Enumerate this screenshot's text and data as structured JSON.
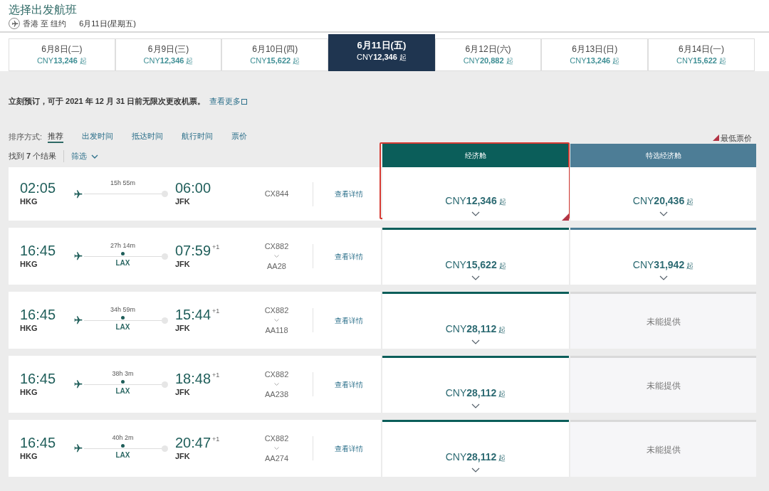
{
  "header": {
    "title": "选择出发航班",
    "route": "香港 至 纽约",
    "date": "6月11日(星期五)"
  },
  "dates": [
    {
      "label": "6月8日(二)",
      "price": "CNY**13,246**",
      "suffix": "起",
      "selected": false
    },
    {
      "label": "6月9日(三)",
      "price": "CNY**12,346**",
      "suffix": "起",
      "selected": false
    },
    {
      "label": "6月10日(四)",
      "price": "CNY**15,622**",
      "suffix": "起",
      "selected": false
    },
    {
      "label": "6月11日(五)",
      "price": "CNY**12,346**",
      "suffix": "起",
      "selected": true
    },
    {
      "label": "6月12日(六)",
      "price": "CNY**20,882**",
      "suffix": "起",
      "selected": false
    },
    {
      "label": "6月13日(日)",
      "price": "CNY**13,246**",
      "suffix": "起",
      "selected": false
    },
    {
      "label": "6月14日(一)",
      "price": "CNY**15,622**",
      "suffix": "起",
      "selected": false
    }
  ],
  "notice": {
    "text": "立刻预订，可于 2021 年 12 月 31 日前无限次更改机票。",
    "link": "查看更多"
  },
  "sort": {
    "label": "排序方式:",
    "options": [
      {
        "label": "推荐",
        "selected": true
      },
      {
        "label": "出发时间",
        "selected": false
      },
      {
        "label": "抵达时间",
        "selected": false
      },
      {
        "label": "航行时间",
        "selected": false
      },
      {
        "label": "票价",
        "selected": false
      }
    ]
  },
  "legend": "最低票价",
  "results": {
    "count": "找到 **7** 个结果",
    "filter": "筛选"
  },
  "cabins": [
    {
      "name": "经济舱",
      "color": "#0b5e5a",
      "highlighted": true
    },
    {
      "name": "特选经济舱",
      "color": "#4d7d96",
      "highlighted": false
    }
  ],
  "flights": [
    {
      "depart": "02:05",
      "from": "HKG",
      "duration": "15h 55m",
      "arrive": "06:00",
      "to": "JFK",
      "numbers": [
        "CX844"
      ],
      "details": "查看详情",
      "fares": [
        {
          "kind": "price",
          "price": "CNY**12,346**",
          "suffix": "起",
          "lowest": true
        },
        {
          "kind": "price",
          "price": "CNY**20,436**",
          "suffix": "起",
          "lowest": false
        }
      ]
    },
    {
      "depart": "16:45",
      "from": "HKG",
      "duration": "27h 14m",
      "stop": "LAX",
      "arrive": "07:59",
      "day_offset": "+1",
      "to": "JFK",
      "numbers": [
        "CX882",
        "AA28"
      ],
      "details": "查看详情",
      "fares": [
        {
          "kind": "price",
          "price": "CNY**15,622**",
          "suffix": "起",
          "lowest": false
        },
        {
          "kind": "price",
          "price": "CNY**31,942**",
          "suffix": "起",
          "lowest": false
        }
      ]
    },
    {
      "depart": "16:45",
      "from": "HKG",
      "duration": "34h 59m",
      "stop": "LAX",
      "arrive": "15:44",
      "day_offset": "+1",
      "to": "JFK",
      "numbers": [
        "CX882",
        "AA118"
      ],
      "details": "查看详情",
      "fares": [
        {
          "kind": "price",
          "price": "CNY**28,112**",
          "suffix": "起",
          "lowest": false
        },
        {
          "kind": "unavailable",
          "text": "未能提供"
        }
      ]
    },
    {
      "depart": "16:45",
      "from": "HKG",
      "duration": "38h 3m",
      "stop": "LAX",
      "arrive": "18:48",
      "day_offset": "+1",
      "to": "JFK",
      "numbers": [
        "CX882",
        "AA238"
      ],
      "details": "查看详情",
      "fares": [
        {
          "kind": "price",
          "price": "CNY**28,112**",
          "suffix": "起",
          "lowest": false
        },
        {
          "kind": "unavailable",
          "text": "未能提供"
        }
      ]
    },
    {
      "depart": "16:45",
      "from": "HKG",
      "duration": "40h 2m",
      "stop": "LAX",
      "arrive": "20:47",
      "day_offset": "+1",
      "to": "JFK",
      "numbers": [
        "CX882",
        "AA274"
      ],
      "details": "查看详情",
      "fares": [
        {
          "kind": "price",
          "price": "CNY**28,112**",
          "suffix": "起",
          "lowest": false
        },
        {
          "kind": "unavailable",
          "text": "未能提供"
        }
      ]
    }
  ]
}
